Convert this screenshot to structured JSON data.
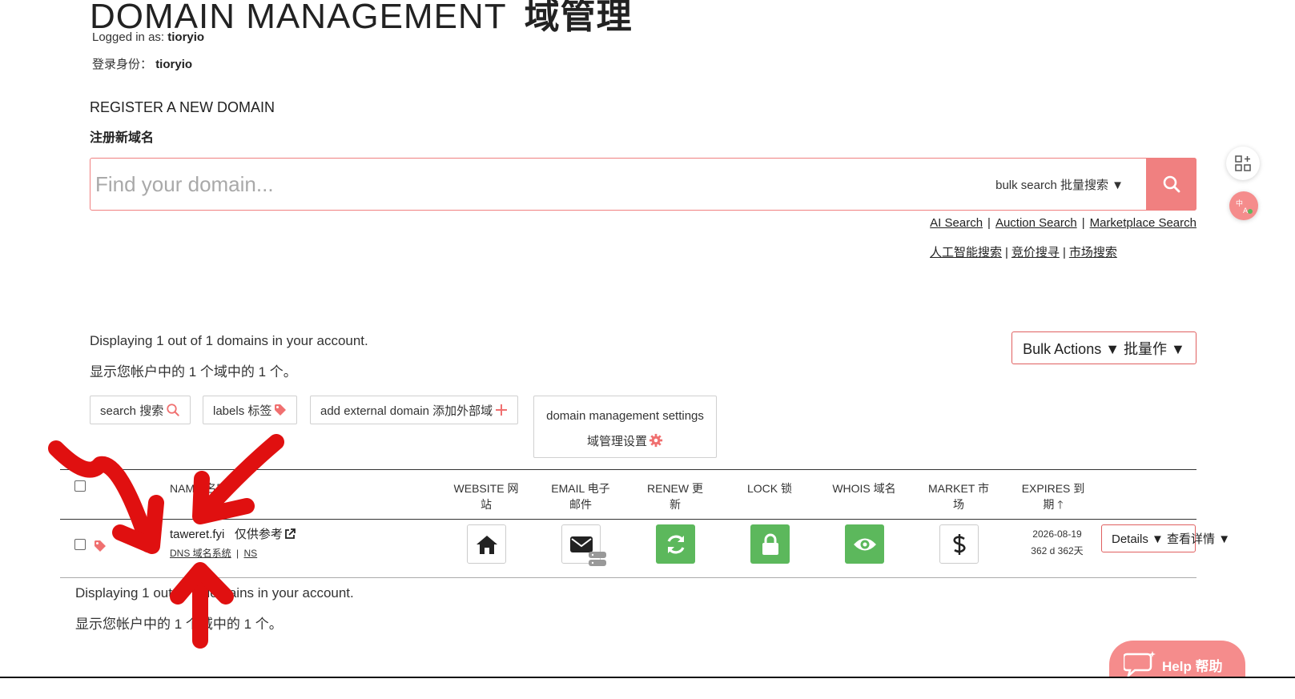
{
  "header": {
    "title_en": "DOMAIN MANAGEMENT",
    "title_cn": "域管理",
    "logged_in_label_en": "Logged in as:",
    "logged_in_label_cn": "登录身份：",
    "username": "tioryio"
  },
  "register": {
    "title_en": "REGISTER A NEW DOMAIN",
    "title_cn": "注册新域名",
    "search_placeholder": "Find your domain...",
    "bulk_search_label": "bulk search  批量搜索 ▼",
    "links_en": [
      "AI Search",
      "Auction Search",
      "Marketplace Search"
    ],
    "links_cn": [
      "人工智能搜索",
      "竞价搜寻",
      "市场搜索"
    ]
  },
  "summary": {
    "top_en": "Displaying 1 out of 1 domains in your account.",
    "top_cn": "显示您帐户中的 1 个域中的 1 个。",
    "bottom_en": "Displaying 1 out of 1 domains in your account.",
    "bottom_cn": "显示您帐户中的 1 个域中的 1 个。"
  },
  "bulk_actions_label": "Bulk Actions ▼  批量作 ▼",
  "toolbar": {
    "search_label": "search  搜索",
    "labels_label": "labels  标签",
    "add_external_label": "add external domain  添加外部域",
    "settings_label_en": "domain management settings",
    "settings_label_cn": "域管理设置"
  },
  "table": {
    "headers": {
      "name": "NAME  名字",
      "website": [
        "WEBSITE  网",
        "站"
      ],
      "email": [
        "EMAIL  电子",
        "邮件"
      ],
      "renew": [
        "RENEW  更",
        "新"
      ],
      "lock": "LOCK  锁",
      "whois": "WHOIS  域名",
      "market": [
        "MARKET  市",
        "场"
      ],
      "expires": [
        "EXPIRES  到",
        "期 🡑"
      ]
    },
    "rows": [
      {
        "domain": "taweret.fyi",
        "note": "仅供参考",
        "dns_link": "DNS  域名系统",
        "ns_link": "NS",
        "expires_date": "2026-08-19",
        "expires_days": "362 d  362天",
        "details_label": "Details ▼  查看详情 ▼"
      }
    ]
  },
  "help_label": "Help  帮助",
  "colors": {
    "accent": "#f08080",
    "green": "#5cb85c",
    "annotation": "#e01010"
  },
  "icons": [
    "search-icon",
    "tag-icon",
    "plus-icon",
    "gear-icon",
    "home-icon",
    "envelope-icon",
    "refresh-icon",
    "lock-icon",
    "eye-icon",
    "dollar-icon",
    "external-link-icon",
    "chat-icon",
    "translate-icon",
    "grid-add-icon"
  ]
}
